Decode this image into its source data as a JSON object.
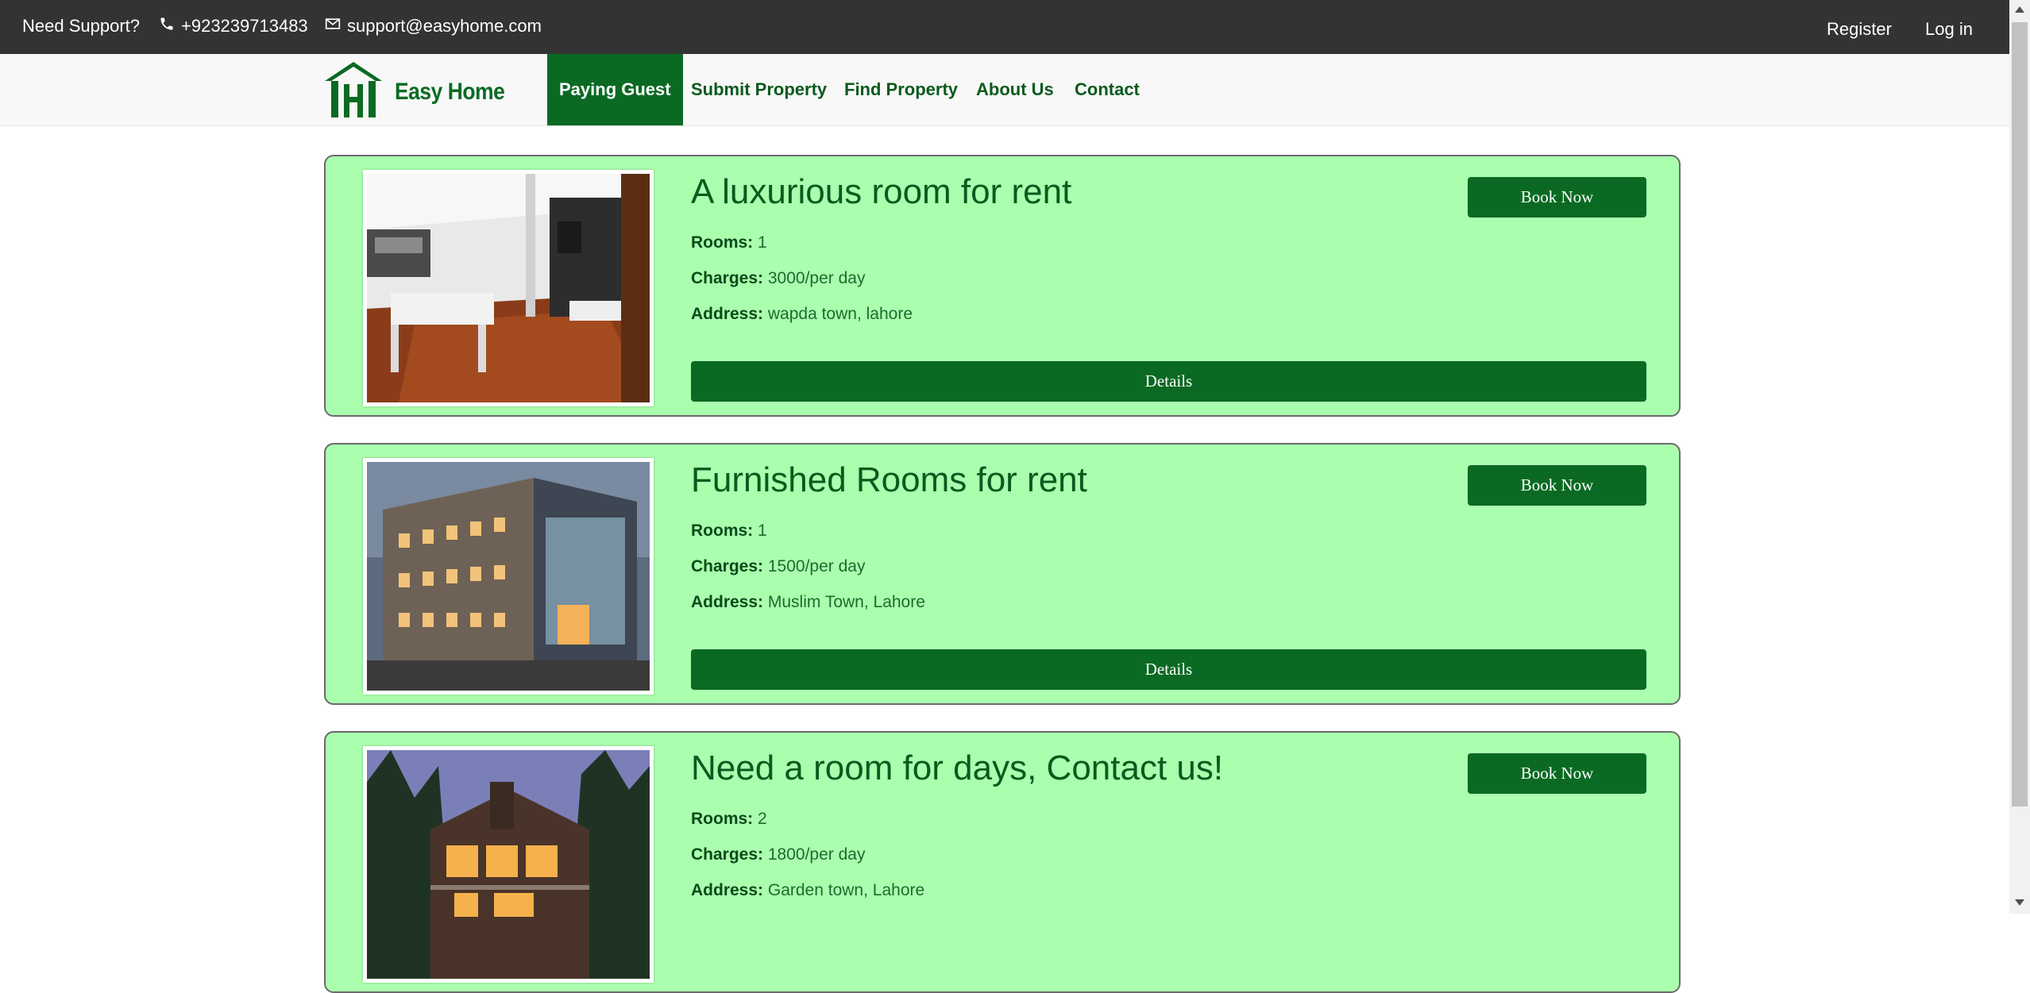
{
  "topbar": {
    "support_label": "Need Support?",
    "phone": "+923239713483",
    "email": "support@easyhome.com",
    "register": "Register",
    "login": "Log in"
  },
  "brand": {
    "name": "Easy Home"
  },
  "nav": {
    "paying_guest": "Paying Guest",
    "submit_property": "Submit Property",
    "find_property": "Find Property",
    "about_us": "About Us",
    "contact": "Contact"
  },
  "labels": {
    "rooms": "Rooms:",
    "charges": "Charges:",
    "address": "Address:",
    "book_now": "Book Now",
    "details": "Details"
  },
  "listings": [
    {
      "title": "A luxurious room for rent",
      "rooms": "1",
      "charges": "3000/per day",
      "address": "wapda town, lahore"
    },
    {
      "title": "Furnished Rooms for rent",
      "rooms": "1",
      "charges": "1500/per day",
      "address": "Muslim Town, Lahore"
    },
    {
      "title": "Need a room for days, Contact us!",
      "rooms": "2",
      "charges": "1800/per day",
      "address": "Garden town, Lahore"
    }
  ],
  "colors": {
    "accent": "#0a6a23",
    "card_background": "#aaffae",
    "topbar": "#333333"
  }
}
